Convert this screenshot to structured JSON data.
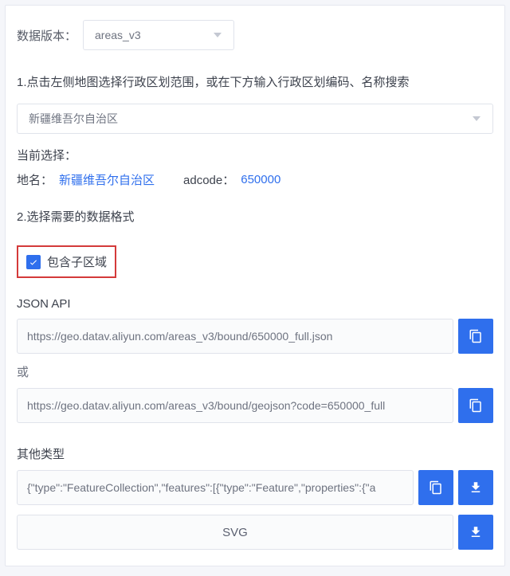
{
  "version": {
    "label": "数据版本：",
    "value": "areas_v3"
  },
  "step1": {
    "text": "1.点击左侧地图选择行政区划范围，或在下方输入行政区划编码、名称搜索"
  },
  "region_select": {
    "value": "新疆维吾尔自治区"
  },
  "current": {
    "label": "当前选择：",
    "name_key": "地名：",
    "name_value": "新疆维吾尔自治区",
    "adcode_key": "adcode：",
    "adcode_value": "650000"
  },
  "step2": {
    "text": "2.选择需要的数据格式"
  },
  "include_sub": {
    "checked": true,
    "label": "包含子区域"
  },
  "json_api": {
    "label": "JSON API",
    "url1": "https://geo.datav.aliyun.com/areas_v3/bound/650000_full.json",
    "or_label": "或",
    "url2": "https://geo.datav.aliyun.com/areas_v3/bound/geojson?code=650000_full"
  },
  "other": {
    "label": "其他类型",
    "body": "{\"type\":\"FeatureCollection\",\"features\":[{\"type\":\"Feature\",\"properties\":{\"a",
    "svg_label": "SVG"
  }
}
